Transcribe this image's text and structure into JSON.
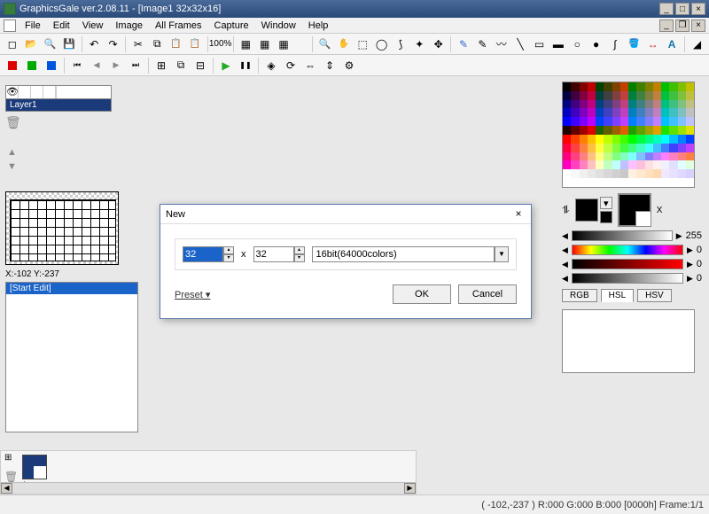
{
  "title": "GraphicsGale ver.2.08.11 - [Image1 32x32x16]",
  "menu": [
    "File",
    "Edit",
    "View",
    "Image",
    "All Frames",
    "Capture",
    "Window",
    "Help"
  ],
  "zoom": "100%",
  "layer": {
    "name": "Layer1"
  },
  "coord": "X:-102 Y:-237",
  "edit_list": {
    "item0": "[Start Edit]"
  },
  "color_tabs": {
    "rgb": "RGB",
    "hsl": "HSL",
    "hsv": "HSV"
  },
  "alpha_value": "255",
  "slider_zero": "0",
  "x_label": "X",
  "frame_index": "1",
  "status": "( -102,-237 ) R:000 G:000 B:000  [0000h]  Frame:1/1",
  "dialog": {
    "title": "New",
    "width": "32",
    "height": "32",
    "x": "x",
    "mode": "16bit(64000colors)",
    "preset": "Preset ▾",
    "ok": "OK",
    "cancel": "Cancel"
  },
  "palette_colors": [
    "#000000",
    "#400000",
    "#800000",
    "#c00000",
    "#004000",
    "#404000",
    "#804000",
    "#c04000",
    "#008000",
    "#408000",
    "#808000",
    "#c08000",
    "#00c000",
    "#40c000",
    "#80c000",
    "#c0c000",
    "#000040",
    "#400040",
    "#800040",
    "#c00040",
    "#004040",
    "#404040",
    "#804040",
    "#c04040",
    "#008040",
    "#408040",
    "#808040",
    "#c08040",
    "#00c040",
    "#40c040",
    "#80c040",
    "#c0c040",
    "#000080",
    "#400080",
    "#800080",
    "#c00080",
    "#004080",
    "#404080",
    "#804080",
    "#c04080",
    "#008080",
    "#408080",
    "#808080",
    "#c08080",
    "#00c080",
    "#40c080",
    "#80c080",
    "#c0c080",
    "#0000c0",
    "#4000c0",
    "#8000c0",
    "#c000c0",
    "#0040c0",
    "#4040c0",
    "#8040c0",
    "#c040c0",
    "#0080c0",
    "#4080c0",
    "#8080c0",
    "#c080c0",
    "#00c0c0",
    "#40c0c0",
    "#80c0c0",
    "#c0c0c0",
    "#0000ff",
    "#4000ff",
    "#8000ff",
    "#c000ff",
    "#0040ff",
    "#4040ff",
    "#8040ff",
    "#c040ff",
    "#0080ff",
    "#4080ff",
    "#8080ff",
    "#c080ff",
    "#00c0ff",
    "#40c0ff",
    "#80c0ff",
    "#c0c0ff",
    "#200000",
    "#600000",
    "#a00000",
    "#e00000",
    "#206000",
    "#606000",
    "#a06000",
    "#e06000",
    "#20a000",
    "#60a000",
    "#a0a000",
    "#e0a000",
    "#20e000",
    "#60e000",
    "#a0e000",
    "#e0e000",
    "#ff0000",
    "#ff4000",
    "#ff8000",
    "#ffc000",
    "#ffff00",
    "#c0ff00",
    "#80ff00",
    "#40ff00",
    "#00ff00",
    "#00ff40",
    "#00ff80",
    "#00ffc0",
    "#00ffff",
    "#00c0ff",
    "#0080ff",
    "#0040ff",
    "#ff0040",
    "#ff4040",
    "#ff8040",
    "#ffc040",
    "#ffff40",
    "#c0ff40",
    "#80ff40",
    "#40ff40",
    "#40ff80",
    "#40ffc0",
    "#40ffff",
    "#40c0ff",
    "#4080ff",
    "#4040ff",
    "#8040ff",
    "#c040ff",
    "#ff0080",
    "#ff4080",
    "#ff8080",
    "#ffc080",
    "#ffff80",
    "#c0ff80",
    "#80ff80",
    "#80ffc0",
    "#80ffff",
    "#80c0ff",
    "#8080ff",
    "#c080ff",
    "#ff80ff",
    "#ff80c0",
    "#ff8080",
    "#ff8040",
    "#ff00c0",
    "#ff40c0",
    "#ff80c0",
    "#ffc0c0",
    "#ffffc0",
    "#c0ffc0",
    "#c0ffff",
    "#c0c0ff",
    "#ffc0ff",
    "#ffc0e0",
    "#ffe0e0",
    "#fff0f0",
    "#f0f0ff",
    "#e0e0ff",
    "#e0ffff",
    "#e0ffe0",
    "#ffffff",
    "#f8f8f8",
    "#f0f0f0",
    "#e8e8e8",
    "#e0e0e0",
    "#d8d8d8",
    "#d0d0d0",
    "#c8c8c8",
    "#fff0e0",
    "#ffe8d0",
    "#ffe0c0",
    "#ffd8b0",
    "#f0e8ff",
    "#e8e0ff",
    "#e0d8ff",
    "#d8d0ff",
    "#ffffff",
    "#ffffff",
    "#ffffff",
    "#ffffff",
    "#ffffff",
    "#ffffff",
    "#ffffff",
    "#ffffff",
    "#ffffff",
    "#ffffff",
    "#ffffff",
    "#ffffff",
    "#ffffff",
    "#ffffff",
    "#ffffff",
    "#ffffff"
  ]
}
